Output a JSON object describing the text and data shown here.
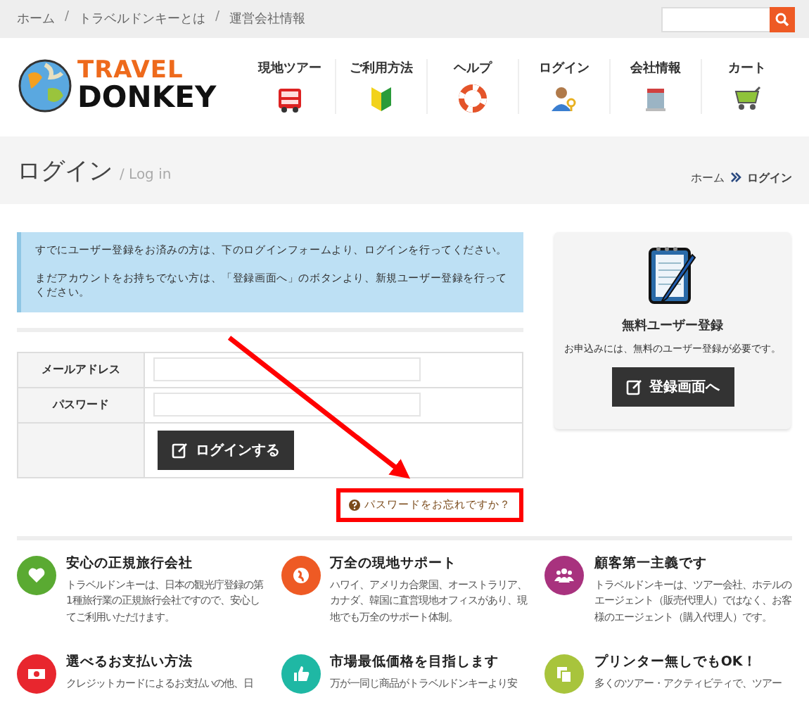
{
  "topbar": {
    "links": [
      {
        "label": "ホーム"
      },
      {
        "label": "トラベルドンキーとは"
      },
      {
        "label": "運営会社情報"
      }
    ],
    "separator": "/"
  },
  "logo": {
    "line1": "TRAVEL",
    "line2": "DONKEY"
  },
  "nav": {
    "items": [
      {
        "label": "現地ツアー"
      },
      {
        "label": "ご利用方法"
      },
      {
        "label": "ヘルプ"
      },
      {
        "label": "ログイン"
      },
      {
        "label": "会社情報"
      },
      {
        "label": "カート"
      }
    ]
  },
  "page_title": {
    "title": "ログイン",
    "subtitle": "/ Log in",
    "breadcrumb": [
      {
        "label": "ホーム",
        "current": false
      },
      {
        "label": "ログイン",
        "current": true
      }
    ]
  },
  "notice": {
    "paragraphs": [
      "すでにユーザー登録をお済みの方は、下のログインフォームより、ログインを行ってください。",
      "まだアカウントをお持ちでない方は、「登録画面へ」のボタンより、新規ユーザー登録を行ってください。"
    ]
  },
  "login_form": {
    "fields": [
      {
        "label": "メールアドレス"
      },
      {
        "label": "パスワード"
      }
    ],
    "submit": "ログインする",
    "forgot_link": "パスワードをお忘れですか？"
  },
  "signup": {
    "title": "無料ユーザー登録",
    "text": "お申込みには、無料のユーザー登録が必要です。",
    "button": "登録画面へ"
  },
  "features": [
    {
      "title": "安心の正規旅行会社",
      "text": "トラベルドンキーは、日本の観光庁登録の第1種旅行業の正規旅行会社ですので、安心してご利用いただけます。",
      "color": "#5aaa32"
    },
    {
      "title": "万全の現地サポート",
      "text": "ハワイ、アメリカ合衆国、オーストラリア、カナダ、韓国に直営現地オフィスがあり、現地でも万全のサポート体制。",
      "color": "#ee5a24"
    },
    {
      "title": "顧客第一主義です",
      "text": "トラベルドンキーは、ツアー会社、ホテルのエージェント（販売代理人）ではなく、お客様のエージェント（購入代理人）です。",
      "color": "#a8327e"
    },
    {
      "title": "選べるお支払い方法",
      "text": "クレジットカードによるお支払いの他、日",
      "color": "#e8262e"
    },
    {
      "title": "市場最低価格を目指します",
      "text": "万が一同じ商品がトラベルドンキーより安",
      "color": "#1fb8a4"
    },
    {
      "title": "プリンター無しでもOK！",
      "text": "多くのツアー・アクティビティで、ツアー",
      "color": "#a8c43c"
    }
  ]
}
